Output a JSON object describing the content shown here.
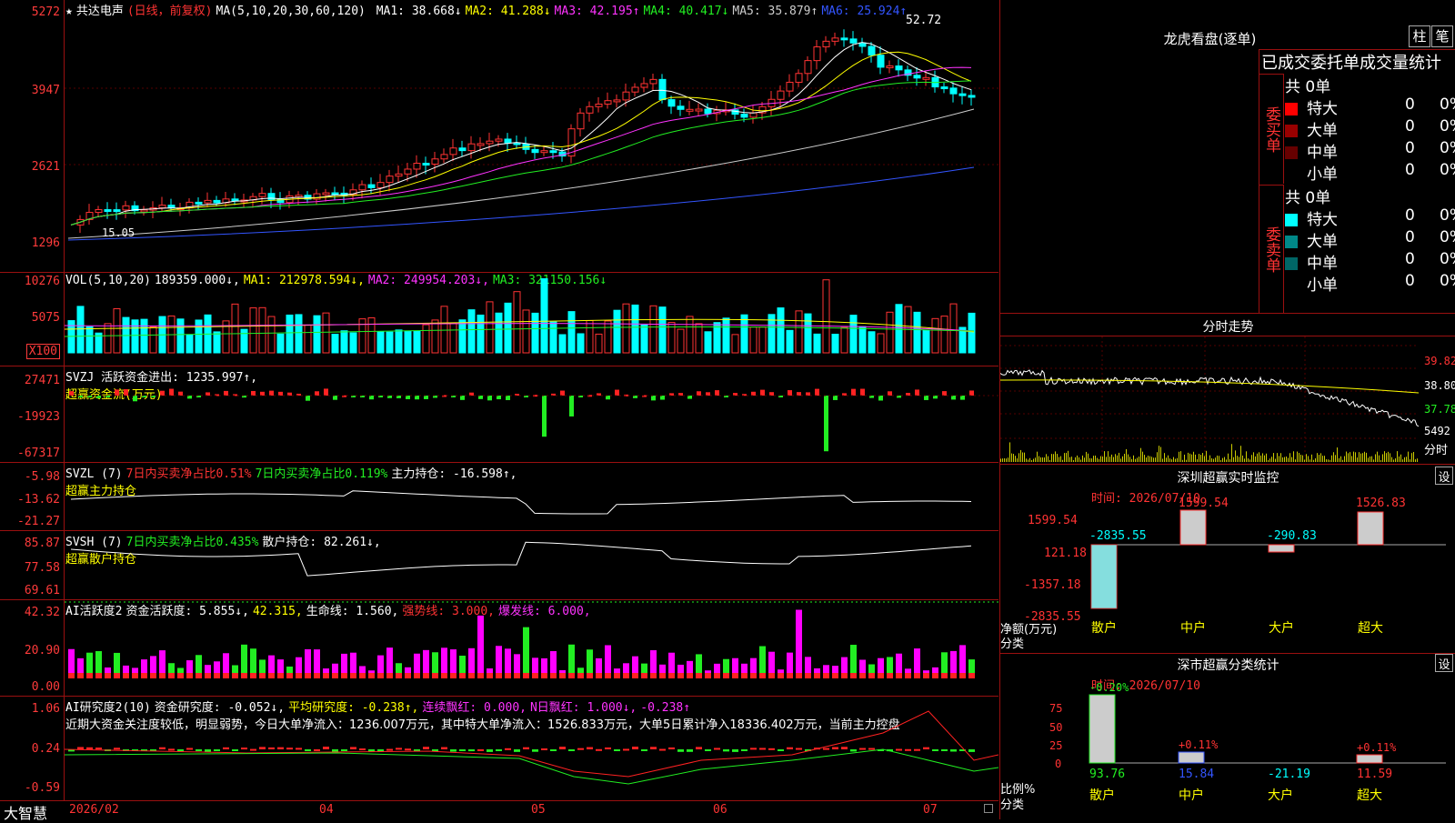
{
  "main": {
    "y_labels": [
      "5272",
      "3947",
      "2621",
      "1296"
    ],
    "title_star": "★",
    "stock": "共达电声",
    "period": "(日线，前复权)",
    "ma_head": "MA(5,10,20,30,60,120)",
    "ma": [
      {
        "label": "MA1:",
        "value": "38.668↓",
        "color": "#ffffff"
      },
      {
        "label": "MA2:",
        "value": "41.288↓",
        "color": "#ffff00"
      },
      {
        "label": "MA3:",
        "value": "42.195↑",
        "color": "#ff33ff"
      },
      {
        "label": "MA4:",
        "value": "40.417↓",
        "color": "#22ee22"
      },
      {
        "label": "MA5:",
        "value": "35.879↑",
        "color": "#cccccc"
      },
      {
        "label": "MA6:",
        "value": "25.924↑",
        "color": "#3355ff"
      }
    ],
    "high_label": "52.72",
    "low_label": "15.05"
  },
  "vol": {
    "y_labels": [
      "10276",
      "5075",
      "X100"
    ],
    "legend": "VOL(5,10,20)",
    "value": "189359.000↓,",
    "ma1": "MA1: 212978.594↓,",
    "ma2": "MA2: 249954.203↓,",
    "ma3": "MA3: 321150.156↓"
  },
  "svzj": {
    "y_labels": [
      "27471",
      "-19923",
      "-67317"
    ],
    "legend": "SVZJ  活跃资金进出: 1235.997↑,",
    "sub": "超赢资金流(万元)"
  },
  "svzl": {
    "y_labels": [
      "-5.98",
      "-13.62",
      "-21.27"
    ],
    "legend_a": "SVZL (7)",
    "legend_b": "7日内买卖净占比0.51%",
    "legend_c": "7日内买卖净占比0.119%",
    "legend_d": "主力持仓: -16.598↑,",
    "sub": "超赢主力持仓"
  },
  "svsh": {
    "y_labels": [
      "85.87",
      "77.58",
      "69.61"
    ],
    "legend_a": "SVSH (7)",
    "legend_b": "7日内买卖净占比0.435%",
    "legend_c": "散户持仓: 82.261↓,",
    "sub": "超赢散户持仓"
  },
  "ai1": {
    "y_labels": [
      "42.32",
      "20.90",
      "0.00"
    ],
    "legend_a": "AI活跃度2",
    "legend_b": "资金活跃度: 5.855↓,",
    "legend_c": "42.315,",
    "legend_d": "生命线: 1.560,",
    "legend_e": "强势线: 3.000,",
    "legend_f": "爆发线: 6.000,"
  },
  "ai2": {
    "y_labels": [
      "1.06",
      "0.24",
      "-0.59"
    ],
    "legend_a": "AI研究度2(10)",
    "legend_b": "资金研究度: -0.052↓,",
    "legend_c": "平均研究度: -0.238↑,",
    "legend_d": "连续飘红: 0.000,",
    "legend_e": "N日飘红: 1.000↓,",
    "legend_f": "-0.238↑",
    "comment": "近期大资金关注度较低，明显弱势，今日大单净流入：1236.007万元，其中特大单净流入：1526.833万元，大单5日累计净入18336.402万元，当前主力控盘"
  },
  "bottom": {
    "brand": "大智慧",
    "dates": [
      "2026/02",
      "04",
      "05",
      "06",
      "07"
    ]
  },
  "right": {
    "lhb_title": "龙虎看盘(逐单)",
    "tab1": "柱",
    "tab2": "笔",
    "stat_title": "已成交委托单成交量统计",
    "buy_label": "委买单",
    "sell_label": "委卖单",
    "buy_total": "共 0单",
    "sell_total": "共 0单",
    "buy_rows": [
      {
        "name": "特大",
        "count": "0",
        "pct": "0%",
        "color": "#ff0000"
      },
      {
        "name": "大单",
        "count": "0",
        "pct": "0%",
        "color": "#990000"
      },
      {
        "name": "中单",
        "count": "0",
        "pct": "0%",
        "color": "#660000"
      },
      {
        "name": "小单",
        "count": "0",
        "pct": "0%",
        "color": ""
      }
    ],
    "sell_rows": [
      {
        "name": "特大",
        "count": "0",
        "pct": "0%",
        "color": "#00ffff"
      },
      {
        "name": "大单",
        "count": "0",
        "pct": "0%",
        "color": "#008888"
      },
      {
        "name": "中单",
        "count": "0",
        "pct": "0%",
        "color": "#006666"
      },
      {
        "name": "小单",
        "count": "0",
        "pct": "0%",
        "color": ""
      }
    ],
    "fs_title": "分时走势",
    "fs_labels": [
      "39.82",
      "38.80",
      "37.78",
      "5492",
      "分时"
    ],
    "sz_title": "深圳超赢实时监控",
    "sz_btn": "设",
    "sz_time": "时间: 2026/07/10",
    "sz_y": [
      "1599.54",
      "121.18",
      "-1357.18",
      "-2835.55"
    ],
    "sz_bars": [
      {
        "cat": "散户",
        "val": "-2835.55"
      },
      {
        "cat": "中户",
        "val": "1599.54"
      },
      {
        "cat": "大户",
        "val": "-290.83"
      },
      {
        "cat": "超大",
        "val": "1526.83"
      }
    ],
    "sz_axis": "净额(万元)",
    "sz_axis2": "分类",
    "fl_title": "深市超赢分类统计",
    "fl_btn": "设",
    "fl_time": "时间: 2026/07/10",
    "fl_y": [
      "75",
      "50",
      "25",
      "0"
    ],
    "fl_bars": [
      {
        "cat": "散户",
        "top": "-0.20%",
        "bottom": "93.76"
      },
      {
        "cat": "中户",
        "top": "+0.11%",
        "bottom": "15.84"
      },
      {
        "cat": "大户",
        "top": "",
        "bottom": "-21.19"
      },
      {
        "cat": "超大",
        "top": "+0.11%",
        "bottom": "11.59"
      }
    ],
    "fl_axis": "比例%",
    "fl_axis2": "分类"
  }
}
